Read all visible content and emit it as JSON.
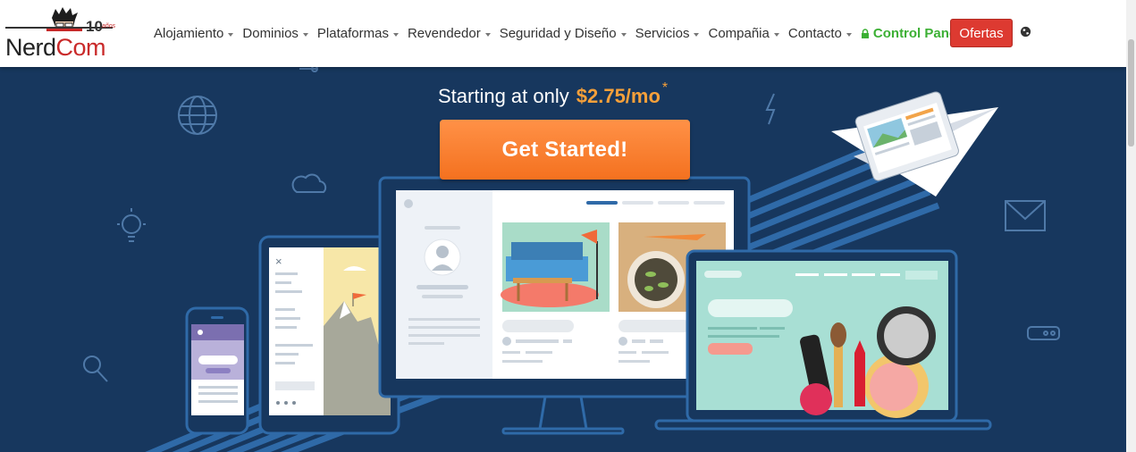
{
  "brand": {
    "name_part1": "Nerd",
    "name_part2": "Com",
    "anniversary": "10",
    "anniversary_suffix": "años"
  },
  "nav": {
    "items": [
      {
        "label": "Alojamiento"
      },
      {
        "label": "Dominios"
      },
      {
        "label": "Plataformas"
      },
      {
        "label": "Revendedor"
      },
      {
        "label": "Seguridad y Diseño"
      },
      {
        "label": "Servicios"
      },
      {
        "label": "Compañia"
      },
      {
        "label": "Contacto"
      }
    ],
    "control_panel": "Control Panel",
    "offers_button": "Ofertas",
    "icons": {
      "lock": "lock-icon",
      "globe": "globe-icon"
    }
  },
  "hero": {
    "headline_prefix": "Starting at only",
    "price": "$2.75/mo",
    "price_footnote": "*",
    "cta_label": "Get Started!",
    "decor_icons": [
      "globe-icon",
      "cloud-icon",
      "lightbulb-icon",
      "magnifier-icon",
      "lightning-icon",
      "mail-icon",
      "server-icon"
    ]
  },
  "colors": {
    "hero_bg": "#17375e",
    "price": "#f6a03a",
    "cta": "#f4711f",
    "control_panel": "#3cb034",
    "offers": "#dd3a31"
  }
}
